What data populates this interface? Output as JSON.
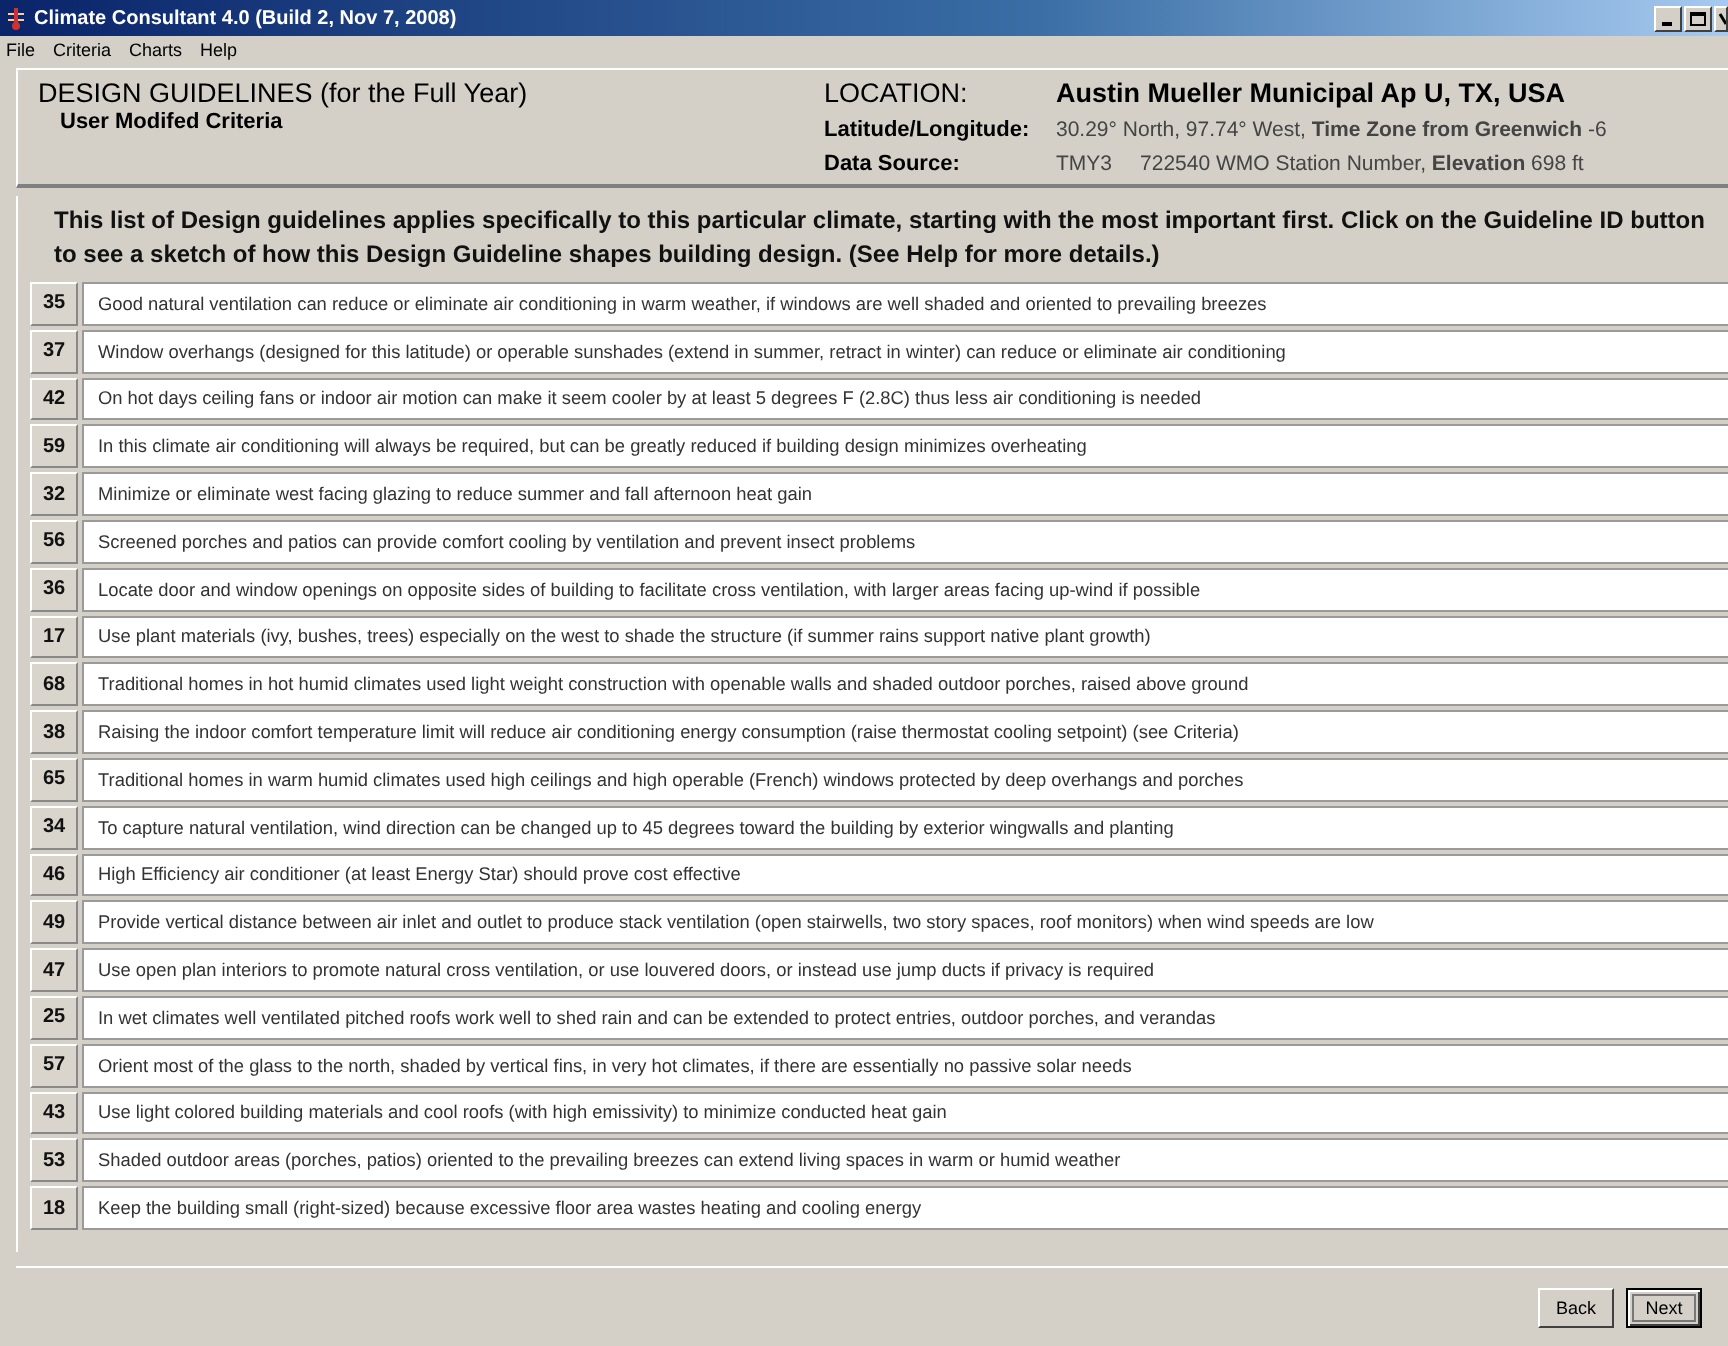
{
  "window": {
    "title": "Climate Consultant 4.0 (Build 2, Nov 7, 2008)"
  },
  "menu": [
    "File",
    "Criteria",
    "Charts",
    "Help"
  ],
  "header": {
    "title": "DESIGN GUIDELINES (for the Full Year)",
    "subtitle": "User Modifed Criteria",
    "location_label": "LOCATION:",
    "location": "Austin Mueller Municipal Ap  U, TX, USA",
    "latlong_label": "Latitude/Longitude:",
    "latlong": "30.29° North, 97.74° West, **Time Zone from Greenwich** -6",
    "source_label": "Data Source:",
    "source_type": "TMY3",
    "source": "722540 WMO Station Number, **Elevation** 698 ft"
  },
  "intro": "This list of Design guidelines applies specifically to this particular climate, starting with the most important first.  Click on the Guideline ID button to see a sketch of how this Design Guideline shapes building design. (See Help for more details.)",
  "guidelines": [
    {
      "id": "35",
      "text": "Good natural ventilation can reduce or eliminate air conditioning in warm weather, if windows are well shaded and oriented to prevailing breezes"
    },
    {
      "id": "37",
      "text": "Window overhangs (designed for this latitude) or operable sunshades (extend in summer, retract in winter) can reduce or eliminate air conditioning"
    },
    {
      "id": "42",
      "text": "On hot days ceiling fans or indoor air motion can make it seem cooler by at least 5 degrees F (2.8C) thus less air conditioning is needed"
    },
    {
      "id": "59",
      "text": "In this climate air conditioning will always be required, but can be greatly reduced if building design minimizes overheating"
    },
    {
      "id": "32",
      "text": "Minimize or eliminate west facing glazing to reduce summer and fall afternoon heat gain"
    },
    {
      "id": "56",
      "text": "Screened porches and patios can provide comfort cooling by ventilation and prevent insect problems"
    },
    {
      "id": "36",
      "text": "Locate door and window openings on opposite sides of building to facilitate cross ventilation, with larger areas facing up-wind if possible"
    },
    {
      "id": "17",
      "text": "Use plant materials (ivy, bushes, trees) especially on the west to shade the structure (if summer rains support native plant growth)"
    },
    {
      "id": "68",
      "text": "Traditional homes in hot humid climates used light weight construction with openable walls and shaded outdoor porches, raised above ground"
    },
    {
      "id": "38",
      "text": "Raising the indoor comfort temperature limit will reduce air conditioning energy consumption (raise thermostat cooling setpoint) (see Criteria)"
    },
    {
      "id": "65",
      "text": "Traditional homes in warm humid climates used high ceilings and high operable (French) windows protected by deep overhangs and porches"
    },
    {
      "id": "34",
      "text": "To capture natural ventilation, wind direction can be changed up to 45 degrees toward the building by exterior wingwalls and planting"
    },
    {
      "id": "46",
      "text": "High Efficiency air conditioner (at least Energy Star) should prove cost effective"
    },
    {
      "id": "49",
      "text": "Provide vertical distance between air inlet and outlet to produce stack ventilation (open stairwells, two story spaces, roof monitors) when wind speeds are low"
    },
    {
      "id": "47",
      "text": "Use open plan interiors to promote natural cross ventilation, or use louvered doors, or instead use jump ducts if privacy is required"
    },
    {
      "id": "25",
      "text": "In wet climates well ventilated pitched roofs work well to shed rain and can be extended to protect entries, outdoor porches, and verandas"
    },
    {
      "id": "57",
      "text": "Orient most of the glass to the north, shaded by vertical fins, in very hot climates, if there are essentially no passive solar needs"
    },
    {
      "id": "43",
      "text": "Use light colored building materials and cool roofs (with high emissivity) to minimize conducted heat gain"
    },
    {
      "id": "53",
      "text": "Shaded outdoor areas (porches, patios) oriented to the prevailing breezes can extend living spaces in warm or humid weather"
    },
    {
      "id": "18",
      "text": "Keep the building small (right-sized) because excessive floor area wastes heating and cooling energy"
    }
  ],
  "buttons": [
    {
      "label": "Back",
      "selected": false
    },
    {
      "label": "Next",
      "selected": true
    }
  ]
}
